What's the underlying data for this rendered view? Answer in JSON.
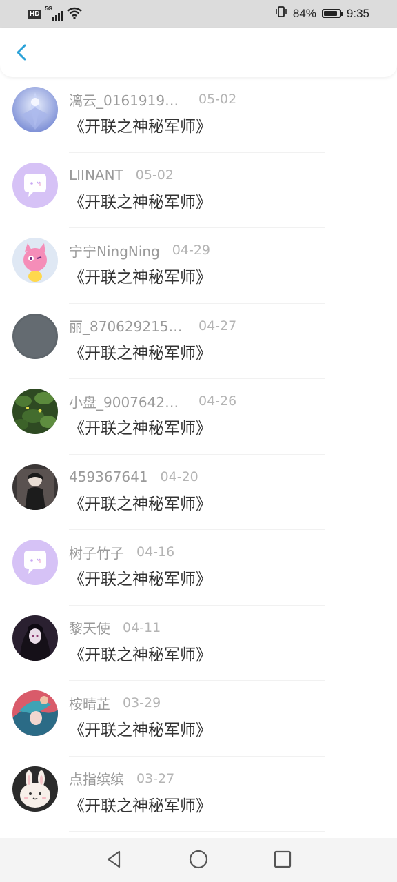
{
  "status_bar": {
    "hd_label": "HD",
    "network_label": "5G",
    "battery_text": "84%",
    "battery_level": 0.84,
    "time": "9:35"
  },
  "header": {
    "back_icon": "chevron-left-icon",
    "accent_color": "#2ba2d8"
  },
  "list": {
    "items": [
      {
        "username": "漓云_0161919…",
        "date": "05-02",
        "title": "《开联之神秘军师》",
        "avatar": "anime-blue-crystal"
      },
      {
        "username": "LIINANT",
        "date": "05-02",
        "title": "《开联之神秘军师》",
        "avatar": "default-chat-bubble"
      },
      {
        "username": "宁宁NingNing",
        "date": "04-29",
        "title": "《开联之神秘军师》",
        "avatar": "pink-creature"
      },
      {
        "username": "丽_870629215…",
        "date": "04-27",
        "title": "《开联之神秘军师》",
        "avatar": "gray-solid"
      },
      {
        "username": "小盘_9007642…",
        "date": "04-26",
        "title": "《开联之神秘军师》",
        "avatar": "green-leaves"
      },
      {
        "username": "459367641",
        "date": "04-20",
        "title": "《开联之神秘军师》",
        "avatar": "dark-figure"
      },
      {
        "username": "树子竹子",
        "date": "04-16",
        "title": "《开联之神秘军师》",
        "avatar": "default-chat-bubble"
      },
      {
        "username": "黎天使",
        "date": "04-11",
        "title": "《开联之神秘军师》",
        "avatar": "dark-anime"
      },
      {
        "username": "桉晴芷",
        "date": "03-29",
        "title": "《开联之神秘军师》",
        "avatar": "blue-hair-anime"
      },
      {
        "username": "点指缤缤",
        "date": "03-27",
        "title": "《开联之神秘军师》",
        "avatar": "white-bunny"
      }
    ]
  },
  "nav_bar": {
    "back_icon": "triangle-back-icon",
    "home_icon": "circle-home-icon",
    "recents_icon": "square-recents-icon"
  }
}
